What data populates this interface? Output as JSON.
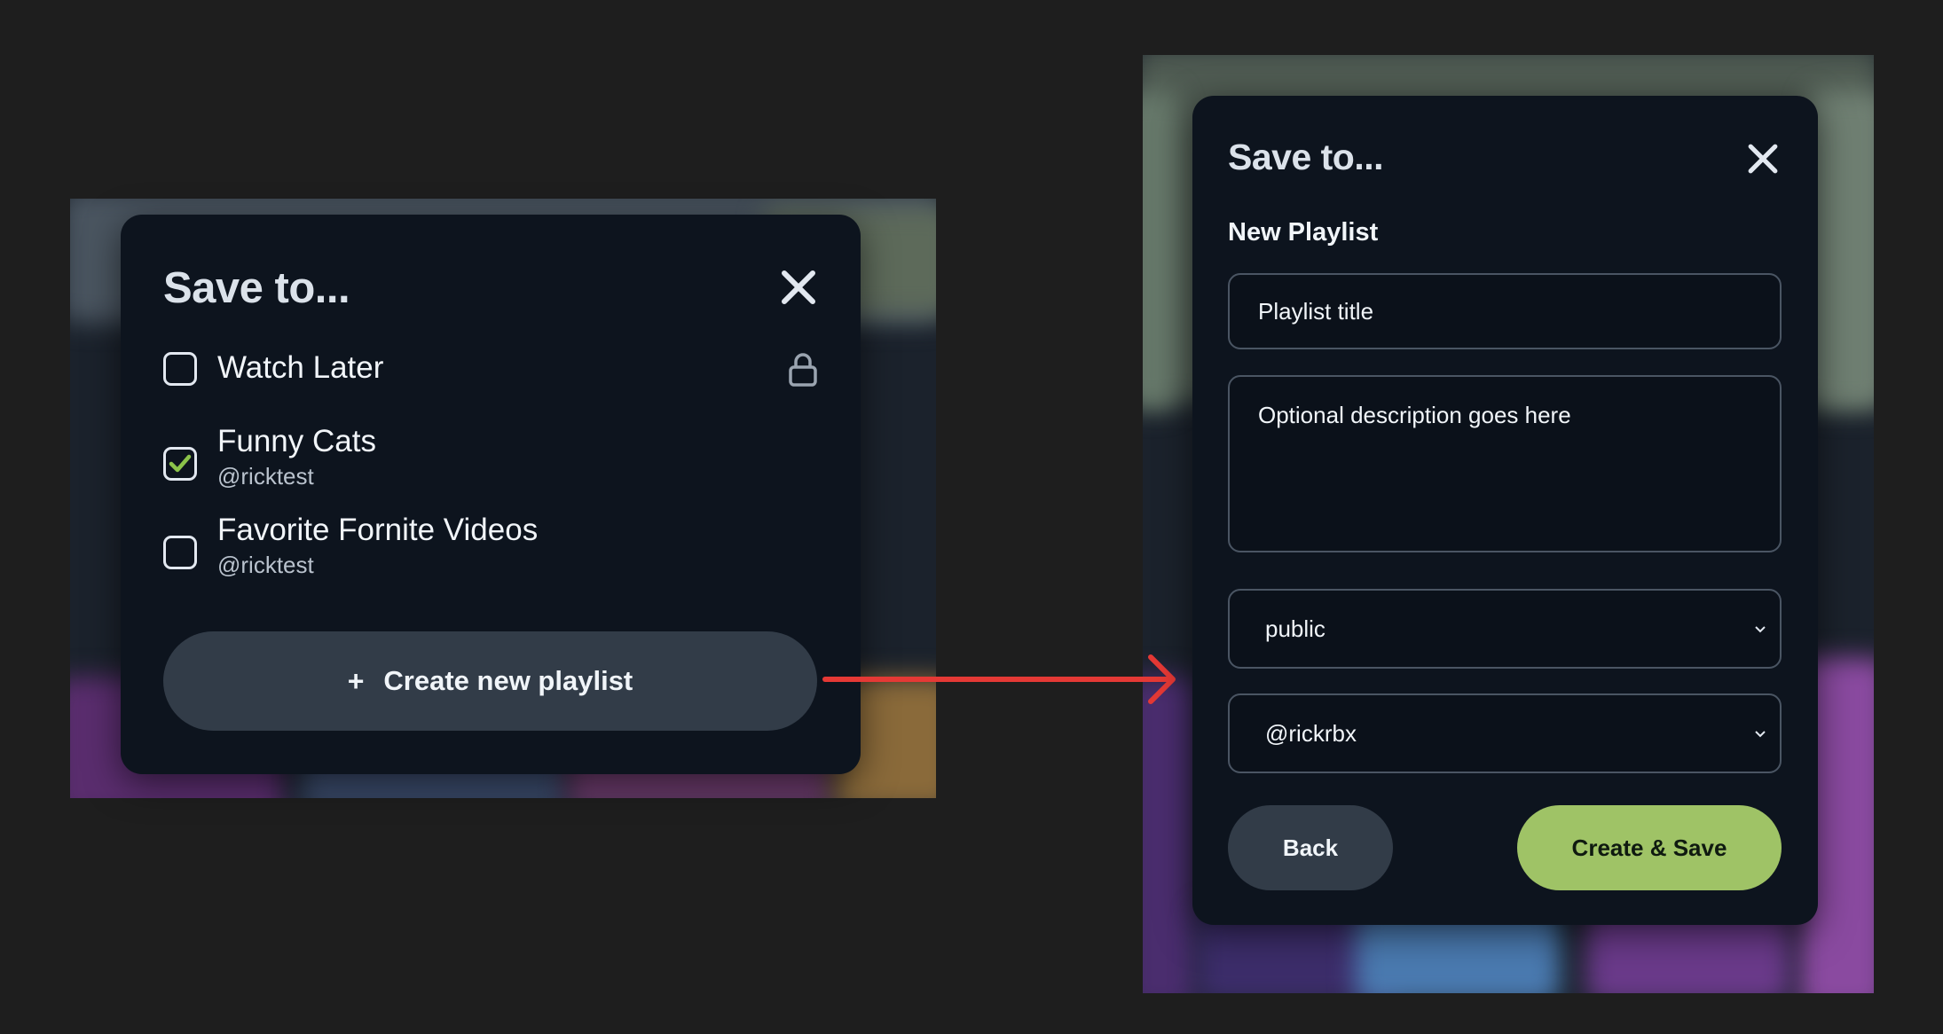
{
  "colors": {
    "accent_green": "#9fc366",
    "check_green": "#8bc34a",
    "dialog_bg": "#0d141e",
    "button_dark": "#323c48",
    "arrow_red": "#e53935"
  },
  "save_dialog": {
    "title": "Save to...",
    "close_icon": "close-icon",
    "playlists": [
      {
        "name": "Watch Later",
        "owner": "",
        "checked": false,
        "private": true
      },
      {
        "name": "Funny Cats",
        "owner": "@ricktest",
        "checked": true,
        "private": false
      },
      {
        "name": "Favorite Fornite Videos",
        "owner": "@ricktest",
        "checked": false,
        "private": false
      }
    ],
    "create_button": {
      "icon": "+",
      "label": "Create new playlist"
    }
  },
  "new_playlist_dialog": {
    "title": "Save to...",
    "section_label": "New Playlist",
    "title_input": {
      "value": "Playlist title"
    },
    "description": {
      "value": "Optional description goes here"
    },
    "visibility_select": {
      "selected": "public"
    },
    "channel_select": {
      "selected": "@rickrbx"
    },
    "back_label": "Back",
    "create_save_label": "Create & Save"
  }
}
